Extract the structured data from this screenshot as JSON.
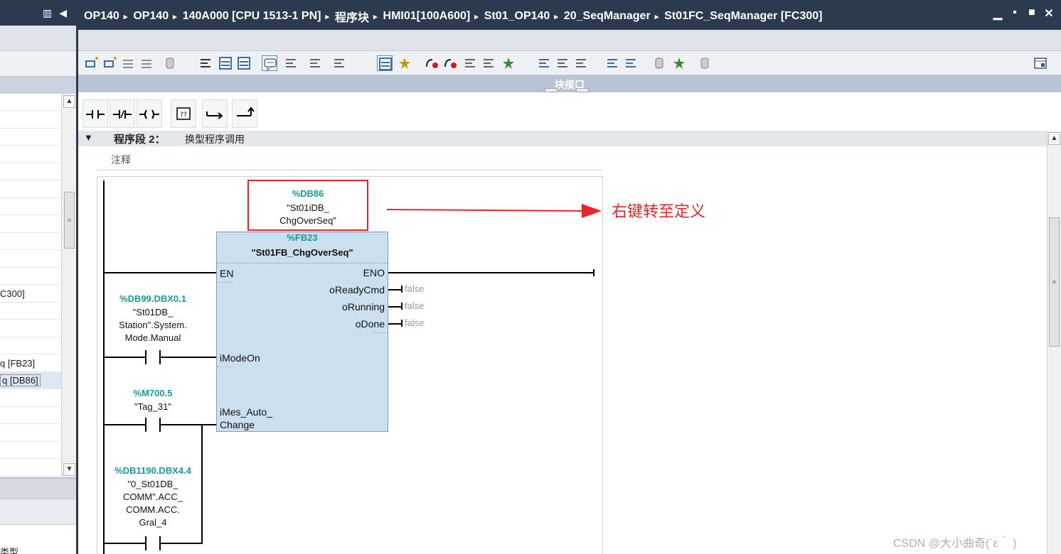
{
  "titlebar": {
    "breadcrumb": [
      "OP140",
      "OP140",
      "140A000 [CPU 1513-1 PN]",
      "程序块",
      "HMI01[100A600]",
      "St01_OP140",
      "20_SeqManager",
      "St01FC_SeqManager [FC300]"
    ],
    "separator": "▸",
    "window_controls": [
      "▁",
      "▪",
      "■",
      "✕"
    ]
  },
  "left_panel": {
    "rows": [
      {
        "text": "",
        "selected": false
      },
      {
        "text": "",
        "selected": false
      },
      {
        "text": "",
        "selected": false
      },
      {
        "text": "",
        "selected": false
      },
      {
        "text": "",
        "selected": false
      },
      {
        "text": "",
        "selected": false
      },
      {
        "text": "",
        "selected": false
      },
      {
        "text": "",
        "selected": false
      },
      {
        "text": "",
        "selected": false
      },
      {
        "text": "",
        "selected": false
      },
      {
        "text": "",
        "selected": false
      },
      {
        "text": "C300]",
        "selected": false
      },
      {
        "text": "",
        "selected": false
      },
      {
        "text": "",
        "selected": false
      },
      {
        "text": "",
        "selected": false
      },
      {
        "text": "q [FB23]",
        "selected": false
      },
      {
        "text": "q [DB86]",
        "selected": true
      },
      {
        "text": "",
        "selected": false
      },
      {
        "text": "",
        "selected": false
      },
      {
        "text": "",
        "selected": false
      },
      {
        "text": "",
        "selected": false
      },
      {
        "text": "",
        "selected": false
      }
    ],
    "bottom_label": "类型"
  },
  "interface_bar": {
    "label": "块接口"
  },
  "network": {
    "label": "程序段 2：",
    "title": "换型程序调用",
    "comment_placeholder": "注释",
    "instance_db": {
      "address": "%DB86",
      "name_line1": "\"St01iDB_",
      "name_line2": "ChgOverSeq\""
    },
    "fb": {
      "address": "%FB23",
      "name": "\"St01FB_ChgOverSeq\""
    },
    "inputs": [
      {
        "pin": "EN"
      },
      {
        "pin": "iModeOn"
      },
      {
        "pin": "iMes_Auto_",
        "pin2": "Change"
      }
    ],
    "outputs": [
      {
        "pin": "ENO",
        "value": ""
      },
      {
        "pin": "oReadyCmd",
        "value": "false"
      },
      {
        "pin": "oRunning",
        "value": "false"
      },
      {
        "pin": "oDone",
        "value": "false"
      }
    ],
    "contacts": [
      {
        "address": "%DB99.DBX0.1",
        "name_lines": [
          "\"St01DB_",
          "Station\".System.",
          "Mode.Manual"
        ]
      },
      {
        "address": "%M700.5",
        "name_lines": [
          "\"Tag_31\""
        ]
      },
      {
        "address": "%DB1190.DBX4.4",
        "name_lines": [
          "\"0_St01DB_",
          "COMM\".ACC_",
          "COMM.ACC.",
          "Gral_4"
        ]
      }
    ]
  },
  "annotation": {
    "text": "右键转至定义",
    "color": "#e8262a"
  },
  "watermark": "CSDN @大小曲奇(´ε｀ )",
  "colors": {
    "titlebar": "#2b3a4f",
    "address_teal": "#1a9b9b",
    "fb_fill": "#cbdfee",
    "annotation_red": "#e8262a"
  }
}
